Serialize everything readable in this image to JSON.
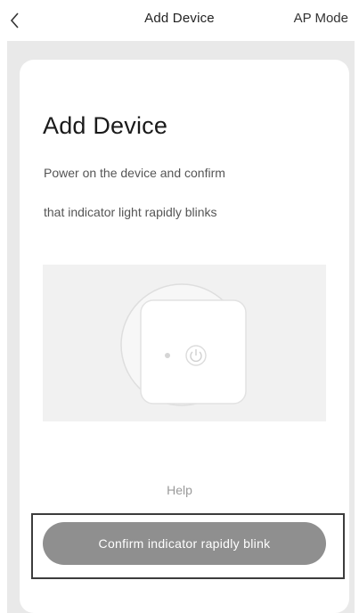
{
  "header": {
    "back_icon": "chevron-left-icon",
    "title": "Add Device",
    "mode_link": "AP Mode"
  },
  "card": {
    "title": "Add Device",
    "description_line_1": "Power on the device and confirm",
    "description_line_2": "that indicator light rapidly blinks",
    "illustration_icon": "power-button-icon"
  },
  "footer": {
    "help_label": "Help",
    "confirm_button_label": "Confirm indicator rapidly blink"
  },
  "colors": {
    "button": "#8f8f8f",
    "background": "#e9e9e9",
    "highlight_frame": "#3c3c3c"
  }
}
